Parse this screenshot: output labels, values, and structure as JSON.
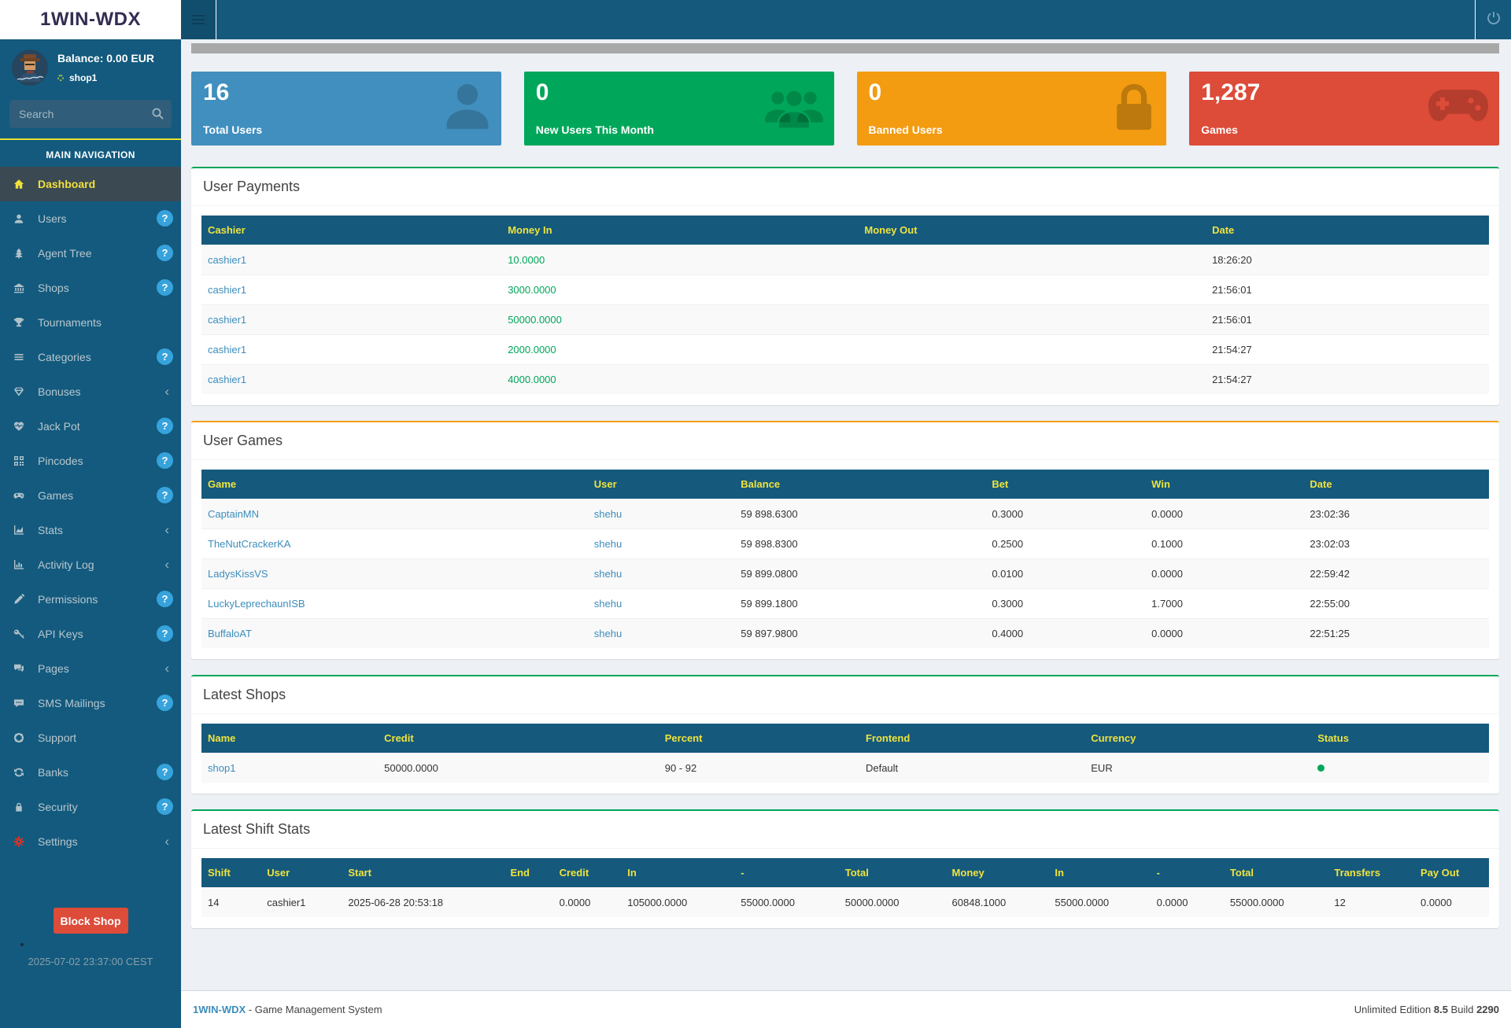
{
  "app": {
    "brand": "1WIN-WDX"
  },
  "topnav": {
    "hamburger_icon": "hamburger-icon",
    "power_icon": "power-icon"
  },
  "sidebar": {
    "balance": "Balance: 0.00 EUR",
    "shop_name": "shop1",
    "search_placeholder": "Search",
    "nav_header": "MAIN NAVIGATION",
    "items": [
      {
        "label": "Dashboard",
        "icon": "home-icon",
        "active": true
      },
      {
        "label": "Users",
        "icon": "user-icon",
        "badge": "?"
      },
      {
        "label": "Agent Tree",
        "icon": "tree-icon",
        "badge": "?"
      },
      {
        "label": "Shops",
        "icon": "bank-icon",
        "badge": "?"
      },
      {
        "label": "Tournaments",
        "icon": "trophy-icon"
      },
      {
        "label": "Categories",
        "icon": "list-icon",
        "badge": "?"
      },
      {
        "label": "Bonuses",
        "icon": "diamond-icon",
        "chevron": true
      },
      {
        "label": "Jack Pot",
        "icon": "heartbeat-icon",
        "badge": "?"
      },
      {
        "label": "Pincodes",
        "icon": "qrcode-icon",
        "badge": "?"
      },
      {
        "label": "Games",
        "icon": "gamepad-icon",
        "badge": "?"
      },
      {
        "label": "Stats",
        "icon": "area-chart-icon",
        "chevron": true
      },
      {
        "label": "Activity Log",
        "icon": "bar-chart-icon",
        "chevron": true
      },
      {
        "label": "Permissions",
        "icon": "pen-icon",
        "badge": "?"
      },
      {
        "label": "API Keys",
        "icon": "key-icon",
        "badge": "?"
      },
      {
        "label": "Pages",
        "icon": "comments-icon",
        "chevron": true
      },
      {
        "label": "SMS Mailings",
        "icon": "comment-icon",
        "badge": "?"
      },
      {
        "label": "Support",
        "icon": "life-ring-icon"
      },
      {
        "label": "Banks",
        "icon": "refresh-icon",
        "badge": "?"
      },
      {
        "label": "Security",
        "icon": "lock-icon",
        "badge": "?"
      },
      {
        "label": "Settings",
        "icon": "gear-icon",
        "chevron": true,
        "icon_color": "#e53022"
      }
    ],
    "block_button": "Block Shop",
    "timestamp": "2025-07-02 23:37:00 CEST"
  },
  "stats": [
    {
      "value": "16",
      "label": "Total Users",
      "color": "#418fbe",
      "icon": "user-icon"
    },
    {
      "value": "0",
      "label": "New Users This Month",
      "color": "#00a65a",
      "icon": "users-group-icon"
    },
    {
      "value": "0",
      "label": "Banned Users",
      "color": "#f39c12",
      "icon": "lock-icon"
    },
    {
      "value": "1,287",
      "label": "Games",
      "color": "#dd4b39",
      "icon": "gamepad-icon"
    }
  ],
  "panels": {
    "user_payments": {
      "title": "User Payments",
      "accent": "#00a65a",
      "headers": [
        "Cashier",
        "Money In",
        "Money Out",
        "Date"
      ],
      "rows": [
        [
          "cashier1",
          "10.0000",
          "",
          "18:26:20"
        ],
        [
          "cashier1",
          "3000.0000",
          "",
          "21:56:01"
        ],
        [
          "cashier1",
          "50000.0000",
          "",
          "21:56:01"
        ],
        [
          "cashier1",
          "2000.0000",
          "",
          "21:54:27"
        ],
        [
          "cashier1",
          "4000.0000",
          "",
          "21:54:27"
        ]
      ]
    },
    "user_games": {
      "title": "User Games",
      "accent": "#f39c12",
      "headers": [
        "Game",
        "User",
        "Balance",
        "Bet",
        "Win",
        "Date"
      ],
      "rows": [
        [
          "CaptainMN",
          "shehu",
          "59 898.6300",
          "0.3000",
          "0.0000",
          "23:02:36"
        ],
        [
          "TheNutCrackerKA",
          "shehu",
          "59 898.8300",
          "0.2500",
          "0.1000",
          "23:02:03"
        ],
        [
          "LadysKissVS",
          "shehu",
          "59 899.0800",
          "0.0100",
          "0.0000",
          "22:59:42"
        ],
        [
          "LuckyLeprechaunISB",
          "shehu",
          "59 899.1800",
          "0.3000",
          "1.7000",
          "22:55:00"
        ],
        [
          "BuffaloAT",
          "shehu",
          "59 897.9800",
          "0.4000",
          "0.0000",
          "22:51:25"
        ]
      ]
    },
    "latest_shops": {
      "title": "Latest Shops",
      "accent": "#00a65a",
      "headers": [
        "Name",
        "Credit",
        "Percent",
        "Frontend",
        "Currency",
        "Status"
      ],
      "rows": [
        [
          "shop1",
          "50000.0000",
          "90 - 92",
          "Default",
          "EUR"
        ]
      ],
      "status_dot_color": "#00a65a"
    },
    "latest_shift_stats": {
      "title": "Latest Shift Stats",
      "accent": "#00a65a",
      "headers": [
        "Shift",
        "User",
        "Start",
        "End",
        "Credit",
        "In",
        "-",
        "Total",
        "Money",
        "In",
        "-",
        "Total",
        "Transfers",
        "Pay Out"
      ],
      "rows": [
        [
          "14",
          "cashier1",
          "2025-06-28 20:53:18",
          "",
          "0.0000",
          "105000.0000",
          "55000.0000",
          "50000.0000",
          "60848.1000",
          "55000.0000",
          "0.0000",
          "55000.0000",
          "12",
          "0.0000"
        ]
      ]
    }
  },
  "footer": {
    "brand": "1WIN-WDX",
    "suffix": " - Game Management System",
    "edition": "Unlimited Edition ",
    "version": "8.5",
    "build_label": " Build ",
    "build_number": "2290"
  }
}
